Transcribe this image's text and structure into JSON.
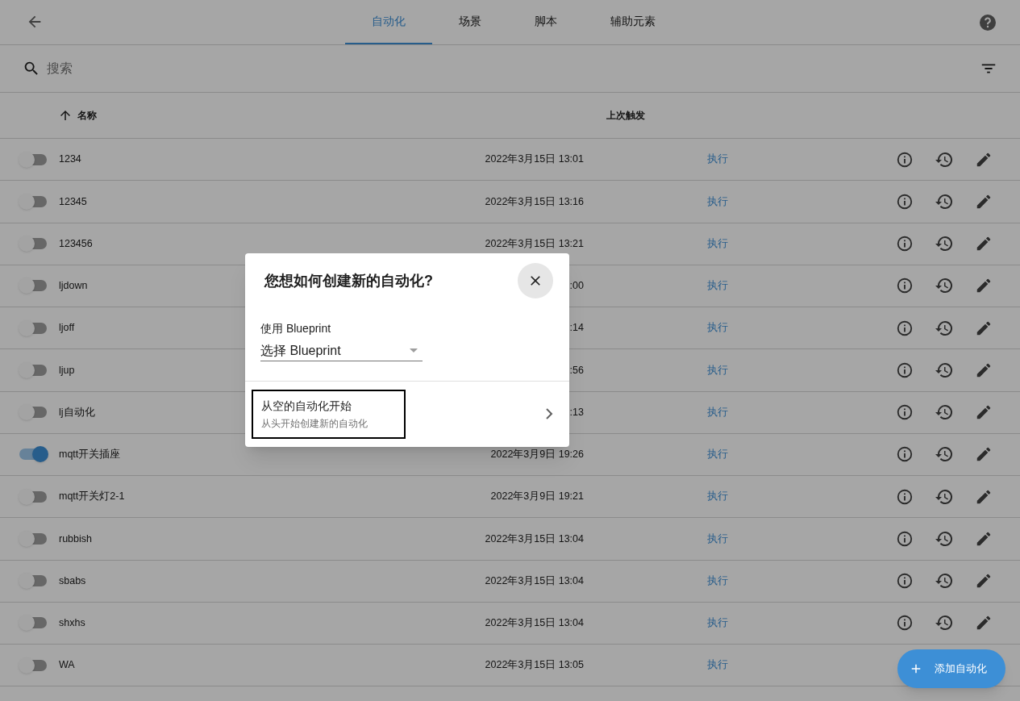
{
  "tabs": [
    {
      "label": "自动化",
      "selected": true
    },
    {
      "label": "场景",
      "selected": false
    },
    {
      "label": "脚本",
      "selected": false
    },
    {
      "label": "辅助元素",
      "selected": false
    }
  ],
  "search": {
    "placeholder": "搜索"
  },
  "columns": [
    {
      "label": "名称",
      "sort_ascending": true
    },
    {
      "label": "上次触发",
      "sort_ascending": false
    }
  ],
  "rows": [
    {
      "name": "1234",
      "on": false,
      "last_triggered": "2022年3月15日 13:01",
      "action": "执行"
    },
    {
      "name": "12345",
      "on": false,
      "last_triggered": "2022年3月15日 13:16",
      "action": "执行"
    },
    {
      "name": "123456",
      "on": false,
      "last_triggered": "2022年3月15日 13:21",
      "action": "执行"
    },
    {
      "name": "ljdown",
      "on": false,
      "last_triggered": ":00",
      "action": "执行"
    },
    {
      "name": "ljoff",
      "on": false,
      "last_triggered": ":14",
      "action": "执行"
    },
    {
      "name": "ljup",
      "on": false,
      "last_triggered": ":56",
      "action": "执行"
    },
    {
      "name": "lj自动化",
      "on": false,
      "last_triggered": ":13",
      "action": "执行"
    },
    {
      "name": "mqtt开关插座",
      "on": true,
      "last_triggered": "2022年3月9日 19:26",
      "action": "执行"
    },
    {
      "name": "mqtt开关灯2-1",
      "on": false,
      "last_triggered": "2022年3月9日 19:21",
      "action": "执行"
    },
    {
      "name": "rubbish",
      "on": false,
      "last_triggered": "2022年3月15日 13:04",
      "action": "执行"
    },
    {
      "name": "sbabs",
      "on": false,
      "last_triggered": "2022年3月15日 13:04",
      "action": "执行"
    },
    {
      "name": "shxhs",
      "on": false,
      "last_triggered": "2022年3月15日 13:04",
      "action": "执行"
    },
    {
      "name": "WA",
      "on": false,
      "last_triggered": "2022年3月15日 13:05",
      "action": "执行"
    }
  ],
  "fab": {
    "label": "添加自动化"
  },
  "dialog": {
    "title": "您想如何创建新的自动化?",
    "blueprint": {
      "label": "使用 Blueprint",
      "value": "选择 Blueprint"
    },
    "options": [
      {
        "title": "从空的自动化开始",
        "subtitle": "从头开始创建新的自动化",
        "focused": true
      }
    ]
  }
}
